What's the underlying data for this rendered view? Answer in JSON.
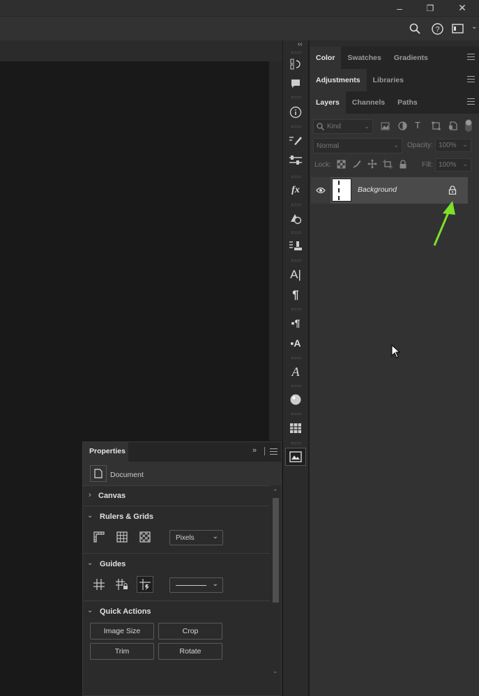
{
  "window": {
    "minimize": "–",
    "restore": "❐",
    "close": "✕"
  },
  "right_tabs_1": [
    "Color",
    "Swatches",
    "Gradients"
  ],
  "right_tabs_2": [
    "Adjustments",
    "Libraries"
  ],
  "right_tabs_3": [
    "Layers",
    "Channels",
    "Paths"
  ],
  "layers": {
    "filter_placeholder": "Kind",
    "blend_mode": "Normal",
    "opacity_label": "Opacity:",
    "opacity_value": "100%",
    "lock_label": "Lock:",
    "fill_label": "Fill:",
    "fill_value": "100%",
    "items": [
      {
        "name": "Background",
        "locked": true,
        "visible": true
      }
    ]
  },
  "properties": {
    "title": "Properties",
    "doc_label": "Document",
    "sections": {
      "canvas": "Canvas",
      "rulers": "Rulers & Grids",
      "guides": "Guides",
      "quick": "Quick Actions"
    },
    "units": "Pixels",
    "buttons": {
      "image_size": "Image Size",
      "crop": "Crop",
      "trim": "Trim",
      "rotate": "Rotate"
    }
  },
  "colors": {
    "accent_arrow": "#7ee02a"
  }
}
